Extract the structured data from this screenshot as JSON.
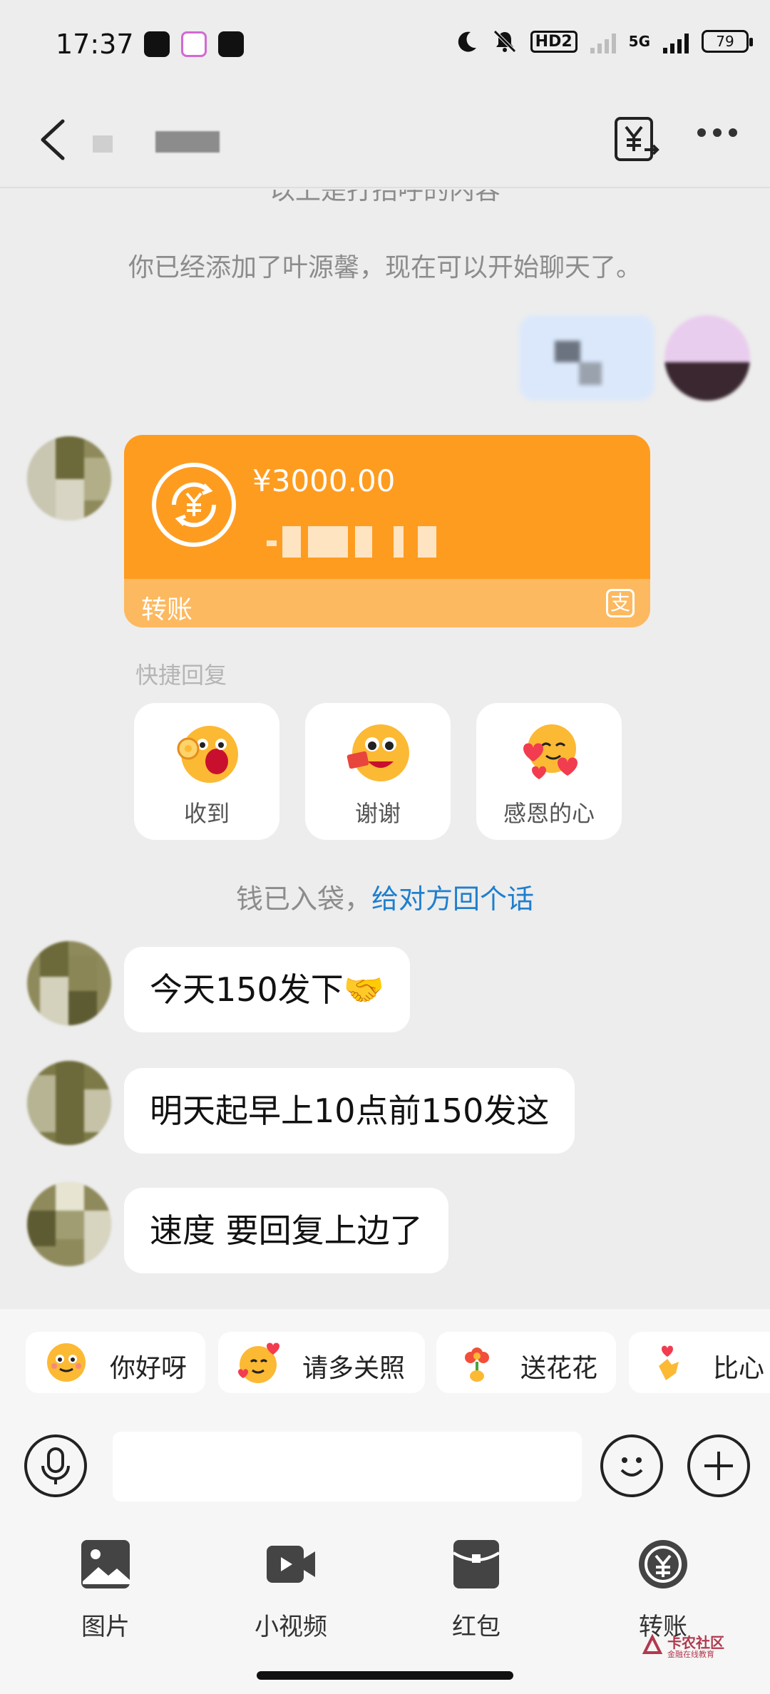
{
  "status_bar": {
    "time": "17:37",
    "hd_label": "HD2",
    "network_label": "5G",
    "battery": "79"
  },
  "header": {
    "icons": {
      "back": "chevron-left-icon",
      "transfer": "yuan-transfer-icon",
      "more": "more-dots-icon"
    }
  },
  "chat": {
    "partial_system_text": "以上是打招呼的内容",
    "added_notice": "你已经添加了叶源馨，现在可以开始聊天了。",
    "transfer": {
      "amount": "¥3000.00",
      "footer_label": "转账",
      "logo_glyph": "支",
      "color": "#fe9c20"
    },
    "quick_reply": {
      "title": "快捷回复",
      "items": [
        {
          "label": "收到",
          "icon": "ok-hand-emoji-icon"
        },
        {
          "label": "谢谢",
          "icon": "thanks-emoji-icon"
        },
        {
          "label": "感恩的心",
          "icon": "hearts-emoji-icon"
        }
      ]
    },
    "money_tip": {
      "text": "钱已入袋，",
      "link": "给对方回个话"
    },
    "messages": [
      {
        "text": "今天150发下🤝"
      },
      {
        "text": "明天起早上10点前150发这"
      },
      {
        "text": "速度 要回复上边了"
      }
    ]
  },
  "suggestion_chips": [
    {
      "label": "你好呀",
      "icon": "smile-emoji-icon"
    },
    {
      "label": "请多关照",
      "icon": "heart-smile-emoji-icon"
    },
    {
      "label": "送花花",
      "icon": "flower-icon"
    },
    {
      "label": "比心",
      "icon": "finger-heart-icon"
    }
  ],
  "input": {
    "value": "",
    "placeholder": ""
  },
  "tools": [
    {
      "label": "图片",
      "icon": "image-icon"
    },
    {
      "label": "小视频",
      "icon": "video-icon"
    },
    {
      "label": "红包",
      "icon": "red-envelope-icon"
    },
    {
      "label": "转账",
      "icon": "transfer-icon"
    }
  ],
  "watermark": {
    "title": "卡农社区",
    "subtitle": "金融在线教育"
  },
  "colors": {
    "accent_link": "#1f7fce",
    "background": "#ededed"
  }
}
